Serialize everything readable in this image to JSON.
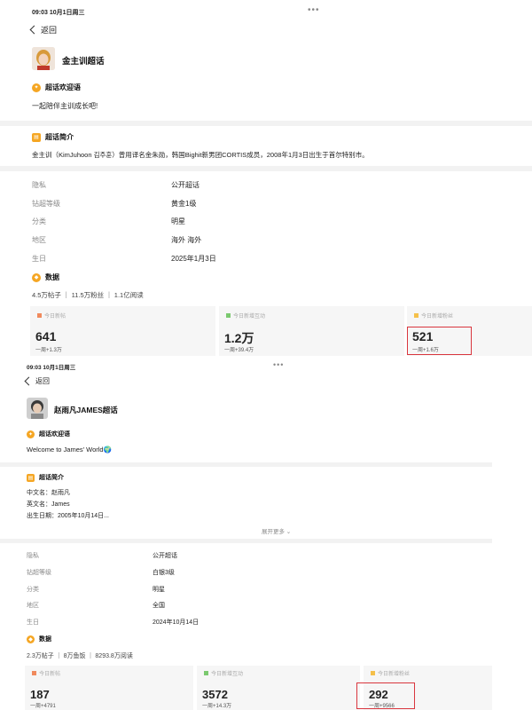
{
  "panel1": {
    "status_time": "09:03  10月1日周三",
    "more_dots": "•••",
    "back_label": "返回",
    "super_title": "金主训超话",
    "welcome_heading": "超话欢迎语",
    "welcome_text": "一起陪伴主训成长吧!",
    "intro_heading": "超话简介",
    "intro_text": "金主训（KimJuhoon 김주훈）曾用译名金朱勋，韩国Bighit新男团CORTIS成员，2008年1月3日出生于首尔特别市。",
    "info": [
      {
        "key": "隐私",
        "value": "公开超话"
      },
      {
        "key": "钻超等级",
        "value": "黄金1级"
      },
      {
        "key": "分类",
        "value": "明星"
      },
      {
        "key": "地区",
        "value": "海外 海外"
      },
      {
        "key": "生日",
        "value": "2025年1月3日"
      }
    ],
    "data_heading": "数据",
    "stats_line": "4.5万帖子 ｜ 11.5万粉丝 ｜ 1.1亿阅读",
    "cards": [
      {
        "label": "今日新帖",
        "value": "641",
        "week": "一周+1.3万",
        "color": "#f08a5d"
      },
      {
        "label": "今日新增互动",
        "value": "1.2万",
        "week": "一周+39.4万",
        "color": "#7bc96f"
      },
      {
        "label": "今日新增粉丝",
        "value": "521",
        "week": "一周+1.6万",
        "color": "#f5c04a"
      }
    ]
  },
  "panel2": {
    "status_time": "09:03  10月1日周三",
    "more_dots": "•••",
    "back_label": "返回",
    "super_title": "赵雨凡JAMES超话",
    "welcome_heading": "超话欢迎语",
    "welcome_text": "Welcome to James' World🌍",
    "intro_heading": "超话简介",
    "intro_lines": [
      "中文名：赵雨凡",
      "英文名：James",
      "出生日期：2005年10月14日..."
    ],
    "expand_label": "展开更多 ⌄",
    "info": [
      {
        "key": "隐私",
        "value": "公开超话"
      },
      {
        "key": "钻超等级",
        "value": "白银3级"
      },
      {
        "key": "分类",
        "value": "明星"
      },
      {
        "key": "地区",
        "value": "全国"
      },
      {
        "key": "生日",
        "value": "2024年10月14日"
      }
    ],
    "data_heading": "数据",
    "stats_line": "2.3万帖子 ｜ 8万鱼饭 ｜ 8293.8万阅读",
    "cards": [
      {
        "label": "今日新帖",
        "value": "187",
        "week": "一周+4791",
        "color": "#f08a5d"
      },
      {
        "label": "今日新增互动",
        "value": "3572",
        "week": "一周+14.3万",
        "color": "#7bc96f"
      },
      {
        "label": "今日新增粉丝",
        "value": "292",
        "week": "一周+9566",
        "color": "#f5c04a"
      }
    ]
  }
}
